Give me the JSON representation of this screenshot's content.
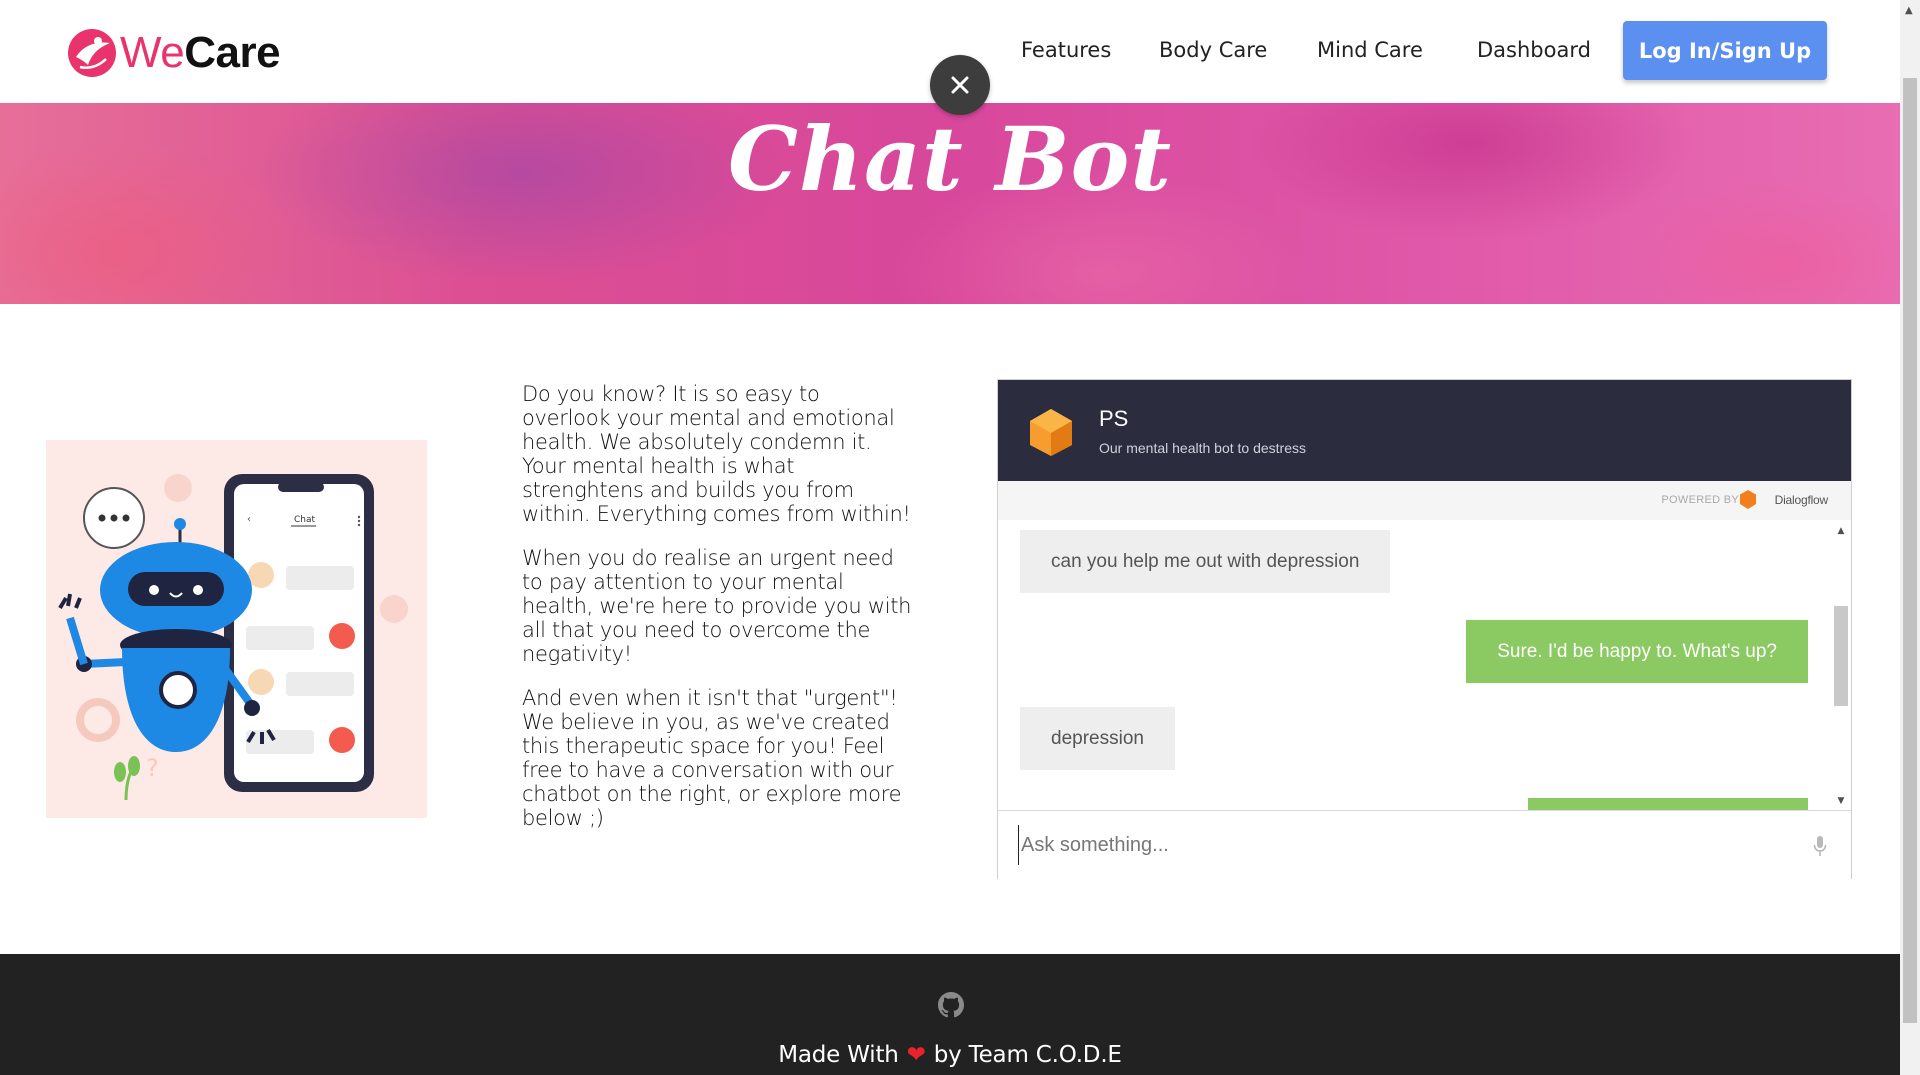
{
  "brand": {
    "name_part1": "We",
    "name_part2": "Care",
    "color": "#e8336d"
  },
  "nav": {
    "items": [
      {
        "label": "Features"
      },
      {
        "label": "Body Care"
      },
      {
        "label": "Mind Care"
      },
      {
        "label": "Dashboard"
      }
    ],
    "login_label": "Log In/Sign Up",
    "login_color": "#5b8ff0"
  },
  "close_icon": "close-icon",
  "banner": {
    "title": "Chat Bot"
  },
  "illustration": {
    "phone_header": "Chat",
    "icons": [
      "robot-illustration",
      "chat-bubble-icon",
      "gear-icon"
    ]
  },
  "info": {
    "paragraphs": [
      "Do you know? It is so easy to overlook your mental and emotional health. We absolutely condemn it. Your mental health is what strenghtens and builds you from within. Everything comes from within!",
      "When you do realise an urgent need to pay attention to your mental health, we're here to provide you with all that you need to overcome the negativity!",
      "And even when it isn't that \"urgent\"! We believe in you, as we've created this therapeutic space for you! Feel free to have a conversation with our chatbot on the right, or explore more below ;)"
    ]
  },
  "chat": {
    "bot_name": "PS",
    "bot_description": "Our mental health bot to destress",
    "powered_by": "POWERED BY",
    "powered_name": "Dialogflow",
    "header_color": "#2b2d3e",
    "user_bubble_color": "#eeeeee",
    "bot_bubble_color": "#8bc963",
    "messages": [
      {
        "from": "user",
        "text": "can you help me out with depression"
      },
      {
        "from": "bot",
        "text": "Sure. I'd be happy to. What's up?"
      },
      {
        "from": "user",
        "text": "depression"
      },
      {
        "from": "bot",
        "text": ""
      }
    ],
    "input_placeholder": "Ask something..."
  },
  "footer": {
    "made_with": "Made With",
    "by_team": "by Team C.O.D.E",
    "heart_icon": "heart-icon",
    "github_icon": "github-icon"
  }
}
